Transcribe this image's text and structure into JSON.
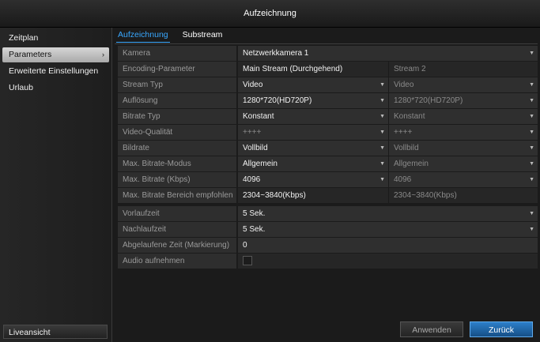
{
  "window": {
    "title": "Aufzeichnung"
  },
  "sidebar": {
    "items": [
      {
        "label": "Zeitplan"
      },
      {
        "label": "Parameters",
        "chevron": "›"
      },
      {
        "label": "Erweiterte Einstellungen"
      },
      {
        "label": "Urlaub"
      }
    ],
    "bottom": "Liveansicht"
  },
  "tabs": [
    "Aufzeichnung",
    "Substream"
  ],
  "form": {
    "camera": {
      "label": "Kamera",
      "value": "Netzwerkkamera 1"
    },
    "params": [
      {
        "label": "Encoding-Parameter",
        "main": "Main Stream (Durchgehend)",
        "sub": "Stream 2"
      },
      {
        "label": "Stream Typ",
        "main": "Video",
        "sub": "Video"
      },
      {
        "label": "Auflösung",
        "main": "1280*720(HD720P)",
        "sub": "1280*720(HD720P)"
      },
      {
        "label": "Bitrate Typ",
        "main": "Konstant",
        "sub": "Konstant"
      },
      {
        "label": "Video-Qualität",
        "main": "++++",
        "sub": "++++"
      },
      {
        "label": "Bildrate",
        "main": "Vollbild",
        "sub": "Vollbild"
      },
      {
        "label": "Max. Bitrate-Modus",
        "main": "Allgemein",
        "sub": "Allgemein"
      },
      {
        "label": "Max. Bitrate (Kbps)",
        "main": "4096",
        "sub": "4096"
      },
      {
        "label": "Max. Bitrate Bereich empfohlen",
        "main": "2304~3840(Kbps)",
        "sub": "2304~3840(Kbps)"
      }
    ],
    "prerecord": {
      "label": "Vorlaufzeit",
      "value": "5 Sek."
    },
    "postrecord": {
      "label": "Nachlaufzeit",
      "value": "5 Sek."
    },
    "expired": {
      "label": "Abgelaufene Zeit (Markierung)",
      "value": "0"
    },
    "audio": {
      "label": "Audio aufnehmen",
      "checked": false
    }
  },
  "buttons": {
    "apply": "Anwenden",
    "back": "Zurück"
  },
  "icons": {
    "dropdown": "chevron-down-icon"
  }
}
